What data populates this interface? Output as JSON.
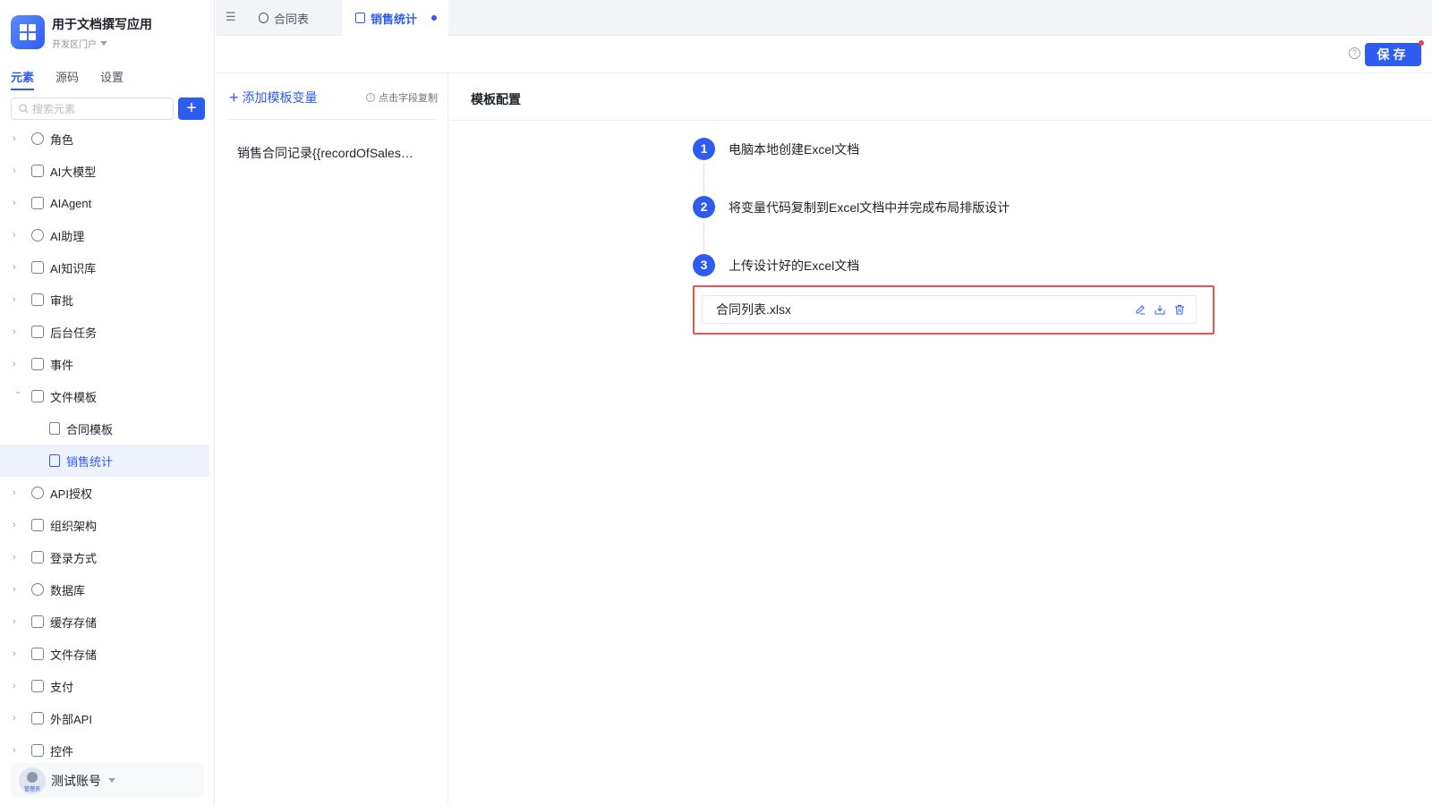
{
  "app": {
    "title": "用于文档撰写应用",
    "env": "开发区门户"
  },
  "sidebar": {
    "tabs": [
      {
        "label": "元素",
        "active": true
      },
      {
        "label": "源码",
        "active": false
      },
      {
        "label": "设置",
        "active": false
      }
    ],
    "search_placeholder": "搜索元素",
    "add_label": "+",
    "items": [
      {
        "label": "角色",
        "icon": "user-group-icon"
      },
      {
        "label": "AI大模型",
        "icon": "cube-icon"
      },
      {
        "label": "AIAgent",
        "icon": "robot-icon"
      },
      {
        "label": "AI助理",
        "icon": "ai-assistant-icon"
      },
      {
        "label": "AI知识库",
        "icon": "book-icon"
      },
      {
        "label": "审批",
        "icon": "stamp-icon"
      },
      {
        "label": "后台任务",
        "icon": "task-icon"
      },
      {
        "label": "事件",
        "icon": "calendar-icon"
      },
      {
        "label": "文件模板",
        "icon": "file-template-icon",
        "expanded": true
      },
      {
        "label": "合同模板",
        "icon": "word-file-icon",
        "child": true
      },
      {
        "label": "销售统计",
        "icon": "excel-file-icon",
        "child": true,
        "selected": true
      },
      {
        "label": "API授权",
        "icon": "key-icon"
      },
      {
        "label": "组织架构",
        "icon": "org-chart-icon"
      },
      {
        "label": "登录方式",
        "icon": "building-icon"
      },
      {
        "label": "数据库",
        "icon": "database-icon"
      },
      {
        "label": "缓存存储",
        "icon": "cache-icon"
      },
      {
        "label": "文件存储",
        "icon": "folder-icon"
      },
      {
        "label": "支付",
        "icon": "payment-icon"
      },
      {
        "label": "外部API",
        "icon": "api-icon"
      },
      {
        "label": "控件",
        "icon": "puzzle-icon"
      }
    ],
    "user": {
      "name": "测试账号",
      "role": "管理员"
    }
  },
  "tabs": [
    {
      "label": "合同表",
      "active": false
    },
    {
      "label": "销售统计",
      "active": true,
      "modified": true
    }
  ],
  "toolbar": {
    "help_icon": "?",
    "save_label": "保存"
  },
  "variables": {
    "add_label": "添加模板变量",
    "hint": "点击字段复制",
    "items": [
      "销售合同记录{{recordOfSalesContract}}"
    ]
  },
  "config": {
    "title": "模板配置",
    "steps": [
      {
        "num": "1",
        "text": "电脑本地创建Excel文档"
      },
      {
        "num": "2",
        "text": "将变量代码复制到Excel文档中并完成布局排版设计"
      },
      {
        "num": "3",
        "text": "上传设计好的Excel文档"
      }
    ],
    "file": {
      "name": "合同列表.xlsx"
    }
  },
  "colors": {
    "primary": "#2f5cf0",
    "highlight": "#f05050"
  }
}
